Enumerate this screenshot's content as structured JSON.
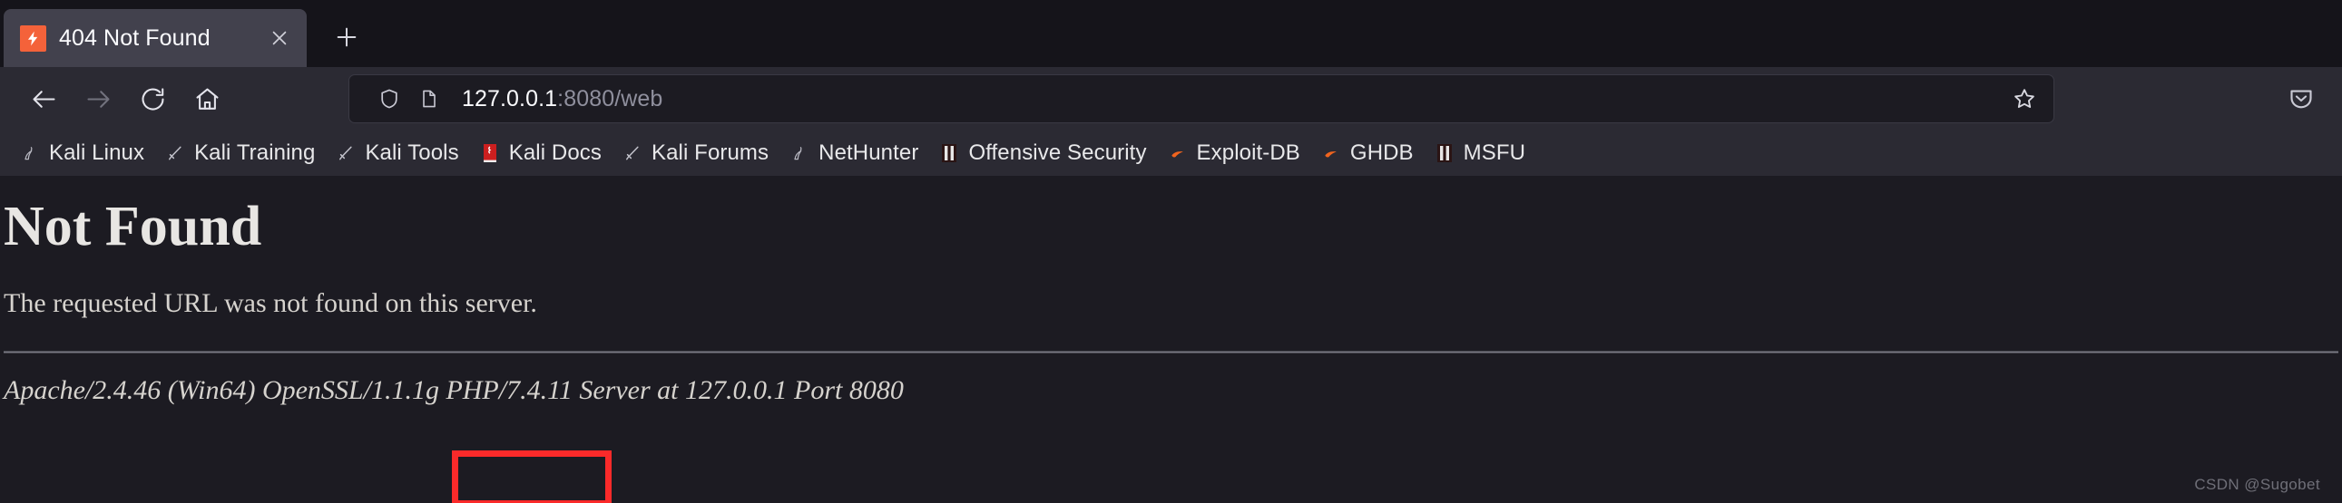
{
  "browser": {
    "tab": {
      "title": "404 Not Found",
      "favicon_name": "xampp-lightning-favicon",
      "favicon_color": "#f4623a",
      "close_label": "×"
    },
    "new_tab_label": "+",
    "nav": {
      "back_label": "Back",
      "forward_label": "Forward",
      "reload_label": "Reload",
      "home_label": "Home"
    },
    "urlbar": {
      "host": "127.0.0.1",
      "path": ":8080/web",
      "full_url": "127.0.0.1:8080/web",
      "shield_icon": "tracking-protection-shield-icon",
      "page_icon": "page-document-icon",
      "star_icon": "bookmark-star-icon"
    },
    "pocket_icon": "pocket-save-icon",
    "bookmarks": [
      {
        "label": "Kali Linux",
        "icon": "kali-dragon-icon"
      },
      {
        "label": "Kali Training",
        "icon": "kali-sword-icon"
      },
      {
        "label": "Kali Tools",
        "icon": "kali-sword-icon"
      },
      {
        "label": "Kali Docs",
        "icon": "kali-docs-book-icon"
      },
      {
        "label": "Kali Forums",
        "icon": "kali-sword-icon"
      },
      {
        "label": "NetHunter",
        "icon": "nethunter-dragon-icon"
      },
      {
        "label": "Offensive Security",
        "icon": "offensive-security-icon"
      },
      {
        "label": "Exploit-DB",
        "icon": "exploit-db-icon"
      },
      {
        "label": "GHDB",
        "icon": "ghdb-icon"
      },
      {
        "label": "MSFU",
        "icon": "msfu-icon"
      }
    ]
  },
  "page": {
    "heading": "Not Found",
    "message": "The requested URL was not found on this server.",
    "server_signature": "Apache/2.4.46 (Win64) OpenSSL/1.1.1g PHP/7.4.11 Server at 127.0.0.1 Port 8080",
    "highlighted_text": "PHP/7.4.11",
    "highlight_color": "#fb2a2a"
  },
  "watermark": "CSDN @Sugobet"
}
